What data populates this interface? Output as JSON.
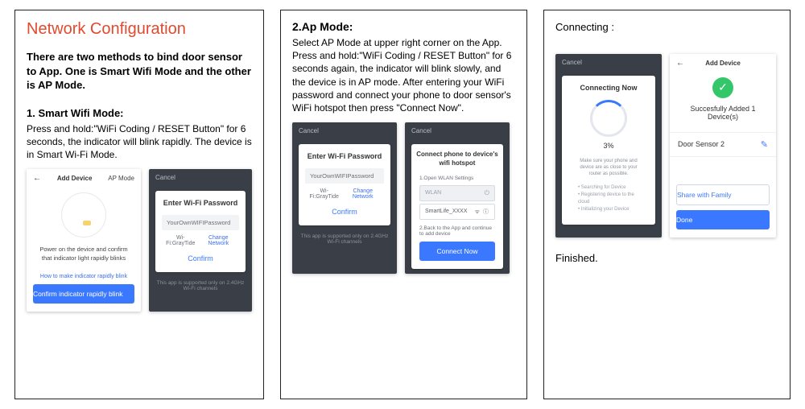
{
  "panel1": {
    "title": "Network Configuration",
    "intro": "There are two methods to bind door sensor to App. One is Smart Wifi Mode and the other is AP Mode.",
    "h": "1. Smart Wifi Mode:",
    "body": "Press and hold:\"WiFi Coding / RESET Button\" for 6 seconds, the indicator will blink rapidly. The device is in Smart Wi-Fi Mode.",
    "shotA": {
      "back": "←",
      "title": "Add Device",
      "mode": "AP Mode",
      "line1": "Power on the device and confirm",
      "line2": "that indicator light rapidly blinks",
      "help": "How to make indicator rapidly blink",
      "btn": "Confirm indicator rapidly blink"
    },
    "shotB": {
      "cancel": "Cancel",
      "title": "Enter Wi-Fi Password",
      "placeholder": "YourOwnWIFIPassword",
      "hint": "Wi-Fi:GrayTide",
      "change": "Change Network",
      "confirm": "Confirm",
      "foot": "This app is supported only on 2.4GHz Wi-Fi channels"
    }
  },
  "panel2": {
    "h": "2.Ap Mode:",
    "body": "Select AP Mode at upper right corner on the App. Press and hold:\"WiFi Coding / RESET Button\" for 6 seconds again, the indicator will blink slowly, and the device is in AP mode. After entering your WiFi password and connect your phone to door sensor's WiFi hotspot then press \"Connect Now\".",
    "shotA": {
      "cancel": "Cancel",
      "title": "Enter Wi-Fi Password",
      "placeholder": "YourOwnWIFIPassword",
      "hint": "Wi-Fi:GrayTide",
      "change": "Change Network",
      "confirm": "Confirm",
      "foot": "This app is supported only on 2.4GHz Wi-Fi channels"
    },
    "shotB": {
      "cancel": "Cancel",
      "title": "Connect phone to device's wifi hotspot",
      "step1": "1.Open WLAN Settings",
      "row1": "WLAN",
      "row2": "SmartLife_XXXX",
      "step2": "2.Back to the App and continue to add device",
      "btn": "Connect Now"
    }
  },
  "panel3": {
    "h": "Connecting :",
    "shotA": {
      "cancel": "Cancel",
      "title": "Connecting Now",
      "pct": "3%",
      "tiny": "Make sure your phone and device are as close to your router as possible.",
      "b1": "Searching for Device",
      "b2": "Registering device to the cloud",
      "b3": "Initializing your Device"
    },
    "shotB": {
      "back": "←",
      "title": "Add Device",
      "ok": "✓",
      "success": "Succesfully Added 1 Device(s)",
      "device": "Door Sensor 2",
      "share": "Share with Family",
      "done": "Done"
    },
    "finished": "Finished."
  }
}
